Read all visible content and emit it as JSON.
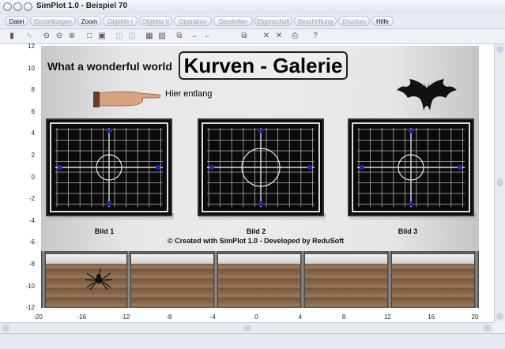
{
  "window": {
    "title": "SimPlot 1.0 - Beispiel 70"
  },
  "menu": [
    {
      "label": "Datei",
      "enabled": true
    },
    {
      "label": "Einstellungen",
      "enabled": false
    },
    {
      "label": "Zoom",
      "enabled": true
    },
    {
      "label": "Objekte I",
      "enabled": false
    },
    {
      "label": "Objekte II",
      "enabled": false
    },
    {
      "label": "Operation",
      "enabled": false
    },
    {
      "label": "Darstellen",
      "enabled": false
    },
    {
      "label": "Eigenschaft",
      "enabled": false
    },
    {
      "label": "Beschriftung",
      "enabled": false
    },
    {
      "label": "Drucken",
      "enabled": false
    },
    {
      "label": "Hilfe",
      "enabled": true
    }
  ],
  "toolbar": [
    {
      "icon": "exit-icon",
      "glyph": "▮",
      "enabled": true
    },
    {
      "icon": "curve-icon",
      "glyph": "∿",
      "enabled": false
    },
    {
      "icon": "zoom-icon",
      "glyph": "⊖",
      "enabled": true
    },
    {
      "icon": "zoom-out-icon",
      "glyph": "⊖",
      "enabled": true
    },
    {
      "icon": "zoom-in-icon",
      "glyph": "⊕",
      "enabled": true
    },
    {
      "icon": "square-icon",
      "glyph": "□",
      "enabled": true
    },
    {
      "icon": "grid-toggle-icon",
      "glyph": "▣",
      "enabled": true
    },
    {
      "icon": "settings-a-icon",
      "glyph": "◫",
      "enabled": false
    },
    {
      "icon": "settings-b-icon",
      "glyph": "◫",
      "enabled": false
    },
    {
      "icon": "table-icon",
      "glyph": "▦",
      "enabled": true
    },
    {
      "icon": "layers-icon",
      "glyph": "▨",
      "enabled": true
    },
    {
      "icon": "copy-right-icon",
      "glyph": "⧉",
      "enabled": true
    },
    {
      "icon": "arrow-right-icon",
      "glyph": "→",
      "enabled": true
    },
    {
      "icon": "arrow-left-icon",
      "glyph": "←",
      "enabled": true
    },
    {
      "icon": "pages-icon",
      "glyph": "⧉",
      "enabled": true
    },
    {
      "icon": "delete-a-icon",
      "glyph": "✕",
      "enabled": true
    },
    {
      "icon": "delete-b-icon",
      "glyph": "✕",
      "enabled": true
    },
    {
      "icon": "print-icon",
      "glyph": "⎙",
      "enabled": true
    },
    {
      "icon": "help-icon",
      "glyph": "?",
      "enabled": true
    }
  ],
  "axes": {
    "y_ticks": [
      "12",
      "10",
      "8",
      "6",
      "4",
      "2",
      "0",
      "-2",
      "-4",
      "-6",
      "-8",
      "-10",
      "-12"
    ],
    "x_ticks": [
      "-20",
      "-16",
      "-12",
      "-8",
      "-4",
      "0",
      "4",
      "8",
      "12",
      "16",
      "20"
    ]
  },
  "gallery": {
    "header_left": "What a wonderful world",
    "title": "Kurven - Galerie",
    "pointer_text": "Hier entlang",
    "pictures": [
      "Bild 1",
      "Bild 2",
      "Bild 3"
    ],
    "copyright": "© Created with SimPlot 1.0 - Developed by ReduSoft"
  },
  "colors": {
    "grid_line": "#b0b0b0",
    "axis_dot": "#1a2bbf",
    "circle": "#e8e8e8"
  }
}
